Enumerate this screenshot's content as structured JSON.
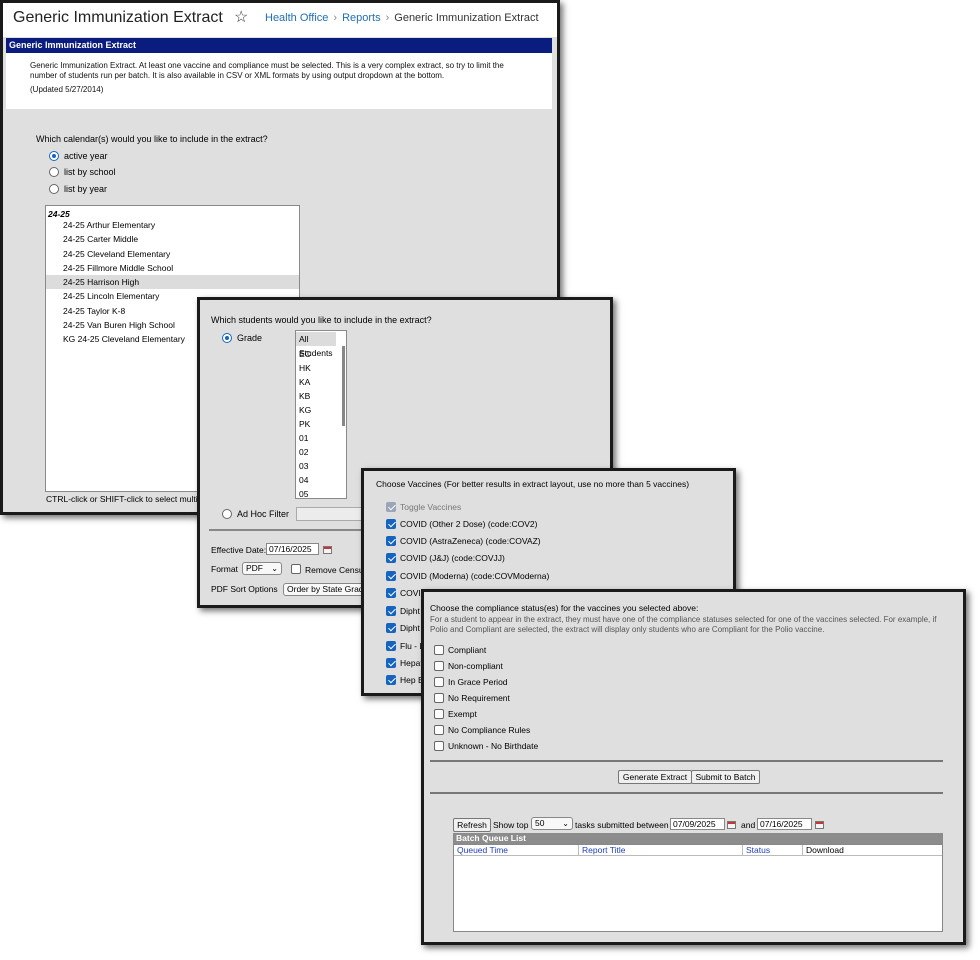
{
  "header": {
    "title": "Generic Immunization Extract",
    "breadcrumbs": [
      "Health Office",
      "Reports",
      "Generic Immunization Extract"
    ]
  },
  "section_title": "Generic Immunization Extract",
  "description": {
    "text": "Generic Immunization Extract. At least one vaccine and compliance must be selected. This is a very complex extract, so try to limit the number of students run per batch. It is also available in CSV or XML formats by using output dropdown at the bottom.",
    "updated": "(Updated 5/27/2014)"
  },
  "calendar_section": {
    "question": "Which calendar(s) would you like to include in the extract?",
    "options": [
      "active year",
      "list by school",
      "list by year"
    ],
    "selected": "active year",
    "group": "24-25",
    "calendars": [
      "24-25 Arthur Elementary",
      "24-25 Carter Middle",
      "24-25 Cleveland Elementary",
      "24-25 Fillmore Middle School",
      "24-25 Harrison High",
      "24-25 Lincoln Elementary",
      "24-25 Taylor K-8",
      "24-25 Van Buren High School",
      "KG 24-25 Cleveland Elementary"
    ],
    "selected_calendar": "24-25 Harrison High",
    "hint": "CTRL-click or SHIFT-click to select multip"
  },
  "student_section": {
    "question": "Which students would you like to include in the extract?",
    "grade_label": "Grade",
    "grades": [
      "All Students",
      "EC",
      "HK",
      "KA",
      "KB",
      "KG",
      "PK",
      "01",
      "02",
      "03",
      "04",
      "05"
    ],
    "selected_grade": "All Students",
    "adhoc_label": "Ad Hoc Filter",
    "effective_date_label": "Effective Date:",
    "effective_date": "07/16/2025",
    "format_label": "Format",
    "format_value": "PDF",
    "remove_census_label": "Remove Censu",
    "sort_label": "PDF Sort Options",
    "sort_value": "Order by State Grad"
  },
  "vaccine_section": {
    "title": "Choose Vaccines (For better results in extract layout, use no more than 5 vaccines)",
    "toggle_label": "Toggle Vaccines",
    "vaccines": [
      "COVID (Other 2 Dose) (code:COV2)",
      "COVID (AstraZeneca) (code:COVAZ)",
      "COVID (J&J) (code:COVJJ)",
      "COVID (Moderna) (code:COVModerna)",
      "COVI",
      "Dipht",
      "Dipht",
      "Flu - L",
      "Hepat",
      "Hep E"
    ]
  },
  "compliance_section": {
    "title": "Choose the compliance status(es) for the vaccines you selected above:",
    "note": "For a student to appear in the extract, they must have one of the compliance statuses selected for one of the vaccines selected. For example, if Polio and Compliant are selected, the extract will display only students who are Compliant for the Polio vaccine.",
    "statuses": [
      "Compliant",
      "Non-compliant",
      "In Grace Period",
      "No Requirement",
      "Exempt",
      "No Compliance Rules",
      "Unknown - No Birthdate"
    ]
  },
  "actions": {
    "generate_label": "Generate Extract",
    "submit_label": "Submit to Batch"
  },
  "batch": {
    "refresh_label": "Refresh",
    "show_top_label": "Show top",
    "show_top_value": "50",
    "between_label": "tasks submitted between",
    "start_date": "07/09/2025",
    "and_label": "and",
    "end_date": "07/16/2025",
    "list_title": "Batch Queue List",
    "columns": [
      "Queued Time",
      "Report Title",
      "Status",
      "Download"
    ]
  },
  "colors": {
    "section_bar": "#0a1d7e",
    "link": "#1f6fb5",
    "checkbox_checked": "#1565c0",
    "panel_bg": "#dfdfdf"
  }
}
